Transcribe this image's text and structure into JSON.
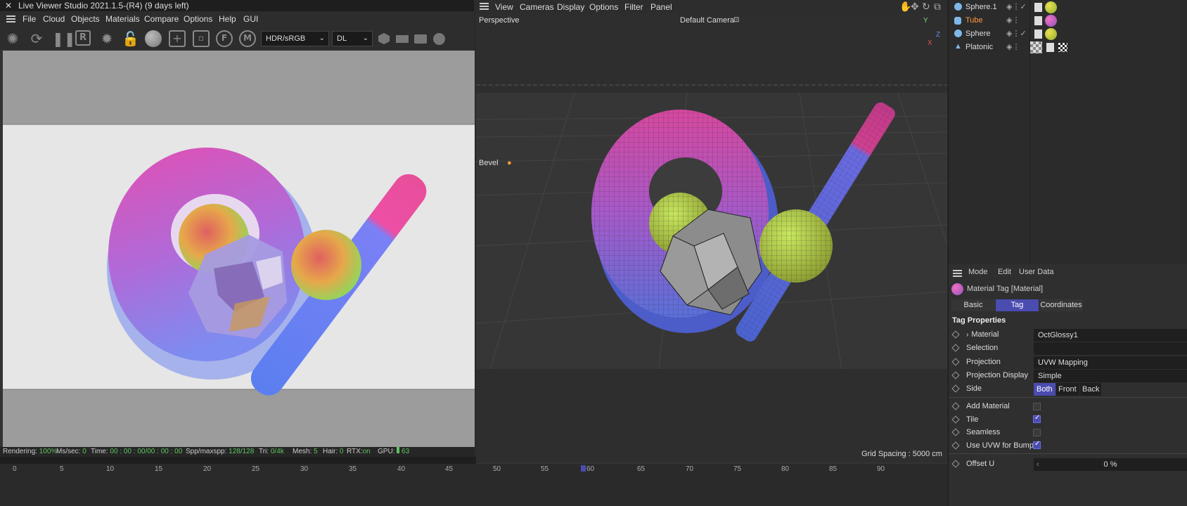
{
  "live_viewer": {
    "title": "Live Viewer Studio 2021.1.5-(R4) (9 days left)",
    "close_glyph": "✕",
    "menu": [
      "File",
      "Cloud",
      "Objects",
      "Materials",
      "Compare",
      "Options",
      "Help",
      "GUI"
    ],
    "tools": [
      "helix-icon",
      "refresh-icon",
      "pause-icon",
      "region-icon",
      "settings-gear-icon",
      "lock-open-icon",
      "sphere-icon",
      "add-object-icon",
      "square-object-icon",
      "f-pin-icon",
      "m-pin-icon"
    ],
    "color_select": "HDR/sRGB",
    "kernel_select": "DL",
    "status": {
      "rendering_label": "Rendering:",
      "rendering_value": "100%",
      "ms_label": "Ms/sec:",
      "ms_value": "0",
      "time_label": "Time:",
      "time_value": "00 : 00 : 00/00 : 00 : 00",
      "spp_label": "Spp/maxspp:",
      "spp_value": "128/128",
      "tri_label": "Tri:",
      "tri_value": "0/4k",
      "mesh_label": "Mesh:",
      "mesh_value": "5",
      "hair_label": "Hair:",
      "hair_value": "0",
      "rtx_label": "RTX:",
      "rtx_value": "on",
      "gpu_label": "GPU:",
      "gpu_value": "63"
    }
  },
  "viewport": {
    "menu": [
      "View",
      "Cameras",
      "Display",
      "Options",
      "Filter",
      "Panel"
    ],
    "mode_label": "Perspective",
    "camera_label": "Default Camera",
    "bevel_label": "Bevel",
    "grid_spacing": "Grid Spacing : 5000 cm",
    "axis": {
      "y": "Y",
      "z": "Z",
      "x": "X"
    }
  },
  "timeline": {
    "ticks": [
      "0",
      "5",
      "10",
      "15",
      "20",
      "25",
      "30",
      "35",
      "40",
      "45",
      "50",
      "55",
      "60",
      "65",
      "70",
      "75",
      "80",
      "85",
      "90"
    ],
    "current": "60"
  },
  "object_manager": {
    "objects": [
      {
        "name": "Sphere.1",
        "color": "#dddddd"
      },
      {
        "name": "Tube",
        "color": "#ff9a3c"
      },
      {
        "name": "Sphere",
        "color": "#dddddd"
      },
      {
        "name": "Platonic",
        "color": "#dddddd"
      }
    ]
  },
  "attributes": {
    "menu": [
      "Mode",
      "Edit",
      "User Data"
    ],
    "header": "Material Tag [Material]",
    "tabs": [
      "Basic",
      "Tag",
      "Coordinates"
    ],
    "active_tab": "Tag",
    "section": "Tag Properties",
    "rows": [
      {
        "label": "Material",
        "value": "OctGlossy1"
      },
      {
        "label": "Selection",
        "value": ""
      },
      {
        "label": "Projection",
        "value": "UVW Mapping"
      },
      {
        "label": "Projection Display",
        "value": "Simple"
      },
      {
        "label": "Side",
        "value": ""
      }
    ],
    "side_options": [
      "Both",
      "Front",
      "Back"
    ],
    "side_selected": "Both",
    "checks": [
      {
        "label": "Add Material",
        "checked": false
      },
      {
        "label": "Tile",
        "checked": true
      },
      {
        "label": "Seamless",
        "checked": false
      },
      {
        "label": "Use UVW for Bump",
        "checked": true
      }
    ],
    "offset_u_label": "Offset U",
    "offset_u_value": "0 %"
  },
  "colors": {
    "accent": "#4a4cb0",
    "status_green": "#5fc35f",
    "tube_orange": "#ff9a3c"
  }
}
